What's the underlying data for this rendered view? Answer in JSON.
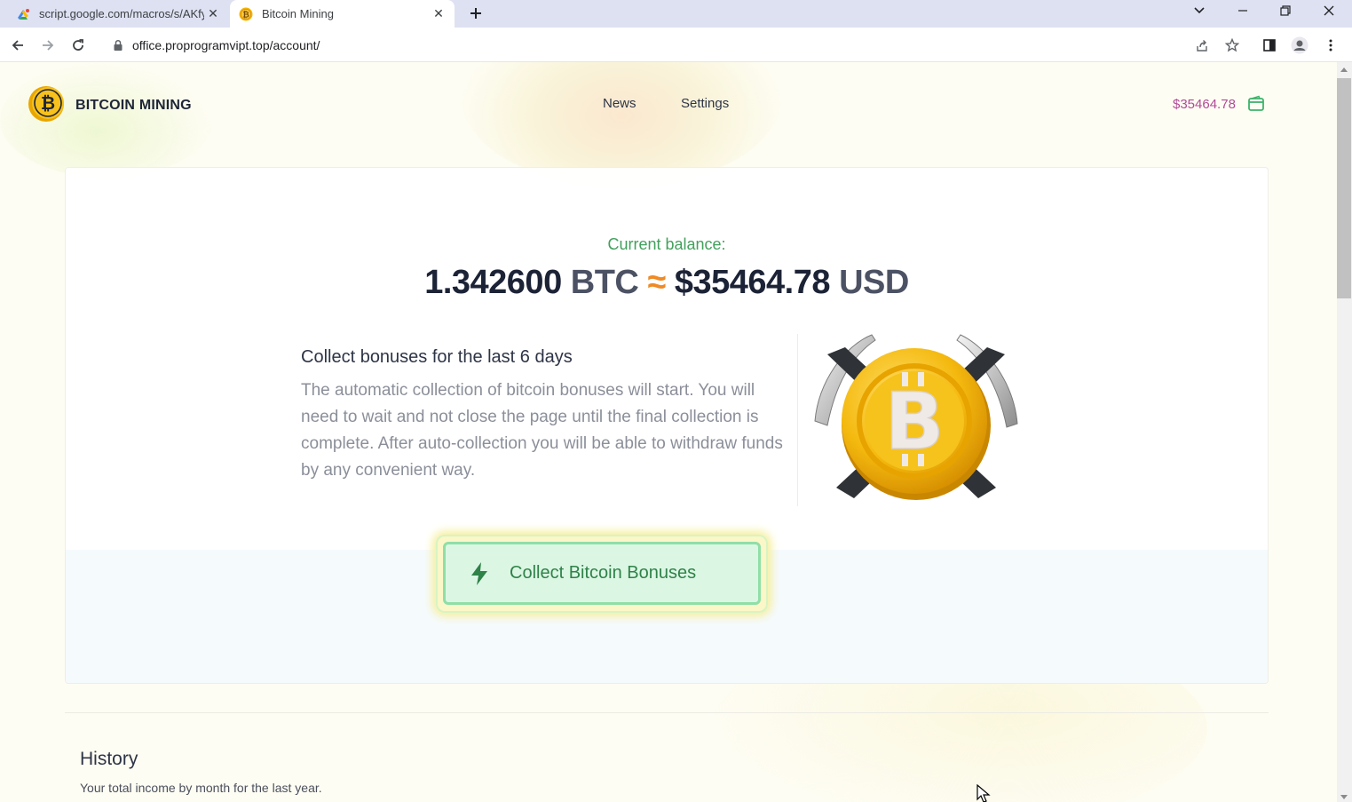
{
  "browser": {
    "tabs": [
      {
        "title": "script.google.com/macros/s/AKfy",
        "active": false,
        "favicon": "google-script-icon"
      },
      {
        "title": "Bitcoin Mining",
        "active": true,
        "favicon": "bitcoin-icon"
      }
    ],
    "url": "office.proprogramvipt.top/account/"
  },
  "site": {
    "name": "BITCOIN MINING",
    "nav": [
      "News",
      "Settings"
    ],
    "header_balance": "$35464.78"
  },
  "balance": {
    "label": "Current balance:",
    "btc_amount": "1.342600",
    "btc_unit": "BTC",
    "approx": "≈",
    "usd_amount": "$35464.78",
    "usd_unit": "USD"
  },
  "bonus": {
    "title": "Collect bonuses for the last 6 days",
    "description": "The automatic collection of bitcoin bonuses will start. You will need to wait and not close the page until the final collection is complete. After auto-collection you will be able to withdraw funds by any convenient way.",
    "button_label": "Collect Bitcoin Bonuses"
  },
  "history": {
    "title": "History",
    "subtitle": "Your total income by month for the last year."
  },
  "colors": {
    "accent_green": "#43a05c",
    "approx_orange": "#f08a24",
    "balance_purple": "#b14a99",
    "button_bg": "#dcf6e4"
  }
}
